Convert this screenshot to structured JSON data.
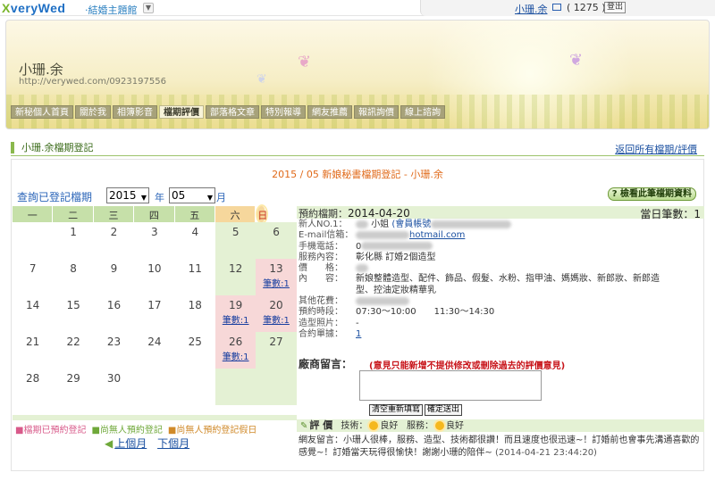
{
  "topbar": {
    "logo_x": "X",
    "logo_rest": "veryWed",
    "theme_link": "·結婚主題館",
    "user_name": "小珊.余",
    "mail_count": "( 1275 )",
    "logout": "登出"
  },
  "banner": {
    "title": "小珊.余",
    "url": "http://verywed.com/0923197556"
  },
  "nav": [
    "新秘個人首頁",
    "關於我",
    "相簿影音",
    "檔期評價",
    "部落格文章",
    "特別報導",
    "網友推薦",
    "報訊詢價",
    "線上諮詢"
  ],
  "section": {
    "title": "小珊.余檔期登記",
    "back_link": "返回所有檔期/評價"
  },
  "calendar": {
    "heading": "2015 / 05 新娘秘書檔期登記 - 小珊.余",
    "query_label": "查詢已登記檔期",
    "year": "2015",
    "year_unit": "年",
    "month": "05",
    "month_unit": "月",
    "weekdays": [
      "一",
      "二",
      "三",
      "四",
      "五",
      "六",
      "日"
    ],
    "weeks": [
      [
        {
          "d": ""
        },
        {
          "d": "1"
        },
        {
          "d": "2"
        },
        {
          "d": "3"
        },
        {
          "d": "4"
        },
        {
          "d": "5"
        },
        {
          "d": "6"
        }
      ],
      [
        {
          "d": "7"
        },
        {
          "d": "8"
        },
        {
          "d": "9"
        },
        {
          "d": "10"
        },
        {
          "d": "11"
        },
        {
          "d": "12"
        },
        {
          "d": "13",
          "c": "筆數:1"
        }
      ],
      [
        {
          "d": "14"
        },
        {
          "d": "15"
        },
        {
          "d": "16"
        },
        {
          "d": "17"
        },
        {
          "d": "18"
        },
        {
          "d": "19",
          "c": "筆數:1"
        },
        {
          "d": "20",
          "c": "筆數:1"
        }
      ],
      [
        {
          "d": "21"
        },
        {
          "d": "22"
        },
        {
          "d": "23"
        },
        {
          "d": "24"
        },
        {
          "d": "25"
        },
        {
          "d": "26",
          "c": "筆數:1"
        },
        {
          "d": "27"
        }
      ],
      [
        {
          "d": "28"
        },
        {
          "d": "29"
        },
        {
          "d": "30"
        },
        {
          "d": ""
        },
        {
          "d": ""
        },
        {
          "d": ""
        },
        {
          "d": ""
        }
      ]
    ],
    "legend": [
      "■檔期已預約登記",
      "■尚無人預約登記",
      "■尚無人預約登記假日"
    ],
    "prev_month": "上個月",
    "next_month": "下個月"
  },
  "detail": {
    "button": "檢看此筆檔期資料",
    "booking_label": "預約檔期：",
    "booking_date": "2014-04-20",
    "daily_count_label": "當日筆數：",
    "daily_count": "1",
    "rows": [
      {
        "label": "新人NO.1：",
        "value": "小姐",
        "link": "(會員帳號"
      },
      {
        "label": "E-mail信箱：",
        "value": "hotmail.com"
      },
      {
        "label": "手機電話：",
        "value": "0"
      },
      {
        "label": "服務內容：",
        "value": "彰化縣 訂婚2個造型"
      },
      {
        "label": "價　　格：",
        "value": ""
      },
      {
        "label": "內　　容：",
        "value": "新娘整體造型、配件、飾品、假髮、水粉、指甲油、媽媽妝、新郎妝、新郎造"
      },
      {
        "label": "",
        "value": "型、控油定妝精華乳"
      },
      {
        "label": "其他花費：",
        "value": ""
      },
      {
        "label": "預約時段：",
        "value": "07:30～10:00　　11:30～14:30"
      },
      {
        "label": "造型照片：",
        "value": "-"
      },
      {
        "label": "合約單據：",
        "value": "1"
      }
    ],
    "msg_label": "廠商留言：",
    "msg_note": "(意見只能新增不提供修改或刪除過去的評價意見)",
    "clear_button": "清空重新填寫",
    "submit_button": "確定送出",
    "review_label": "評 價",
    "tech_label": "技術：",
    "tech_value": "良好",
    "service_label": "服務：",
    "service_value": "良好",
    "review_text": "網友留言：小珊人很棒，服務、造型、技術都很讚！而且速度也很迅速~！訂婚前也會事先溝通喜歡的感覺~！訂婚當天玩得很愉快！謝謝小珊的陪伴~",
    "review_time": "(2014-04-21 23:44:20)"
  }
}
